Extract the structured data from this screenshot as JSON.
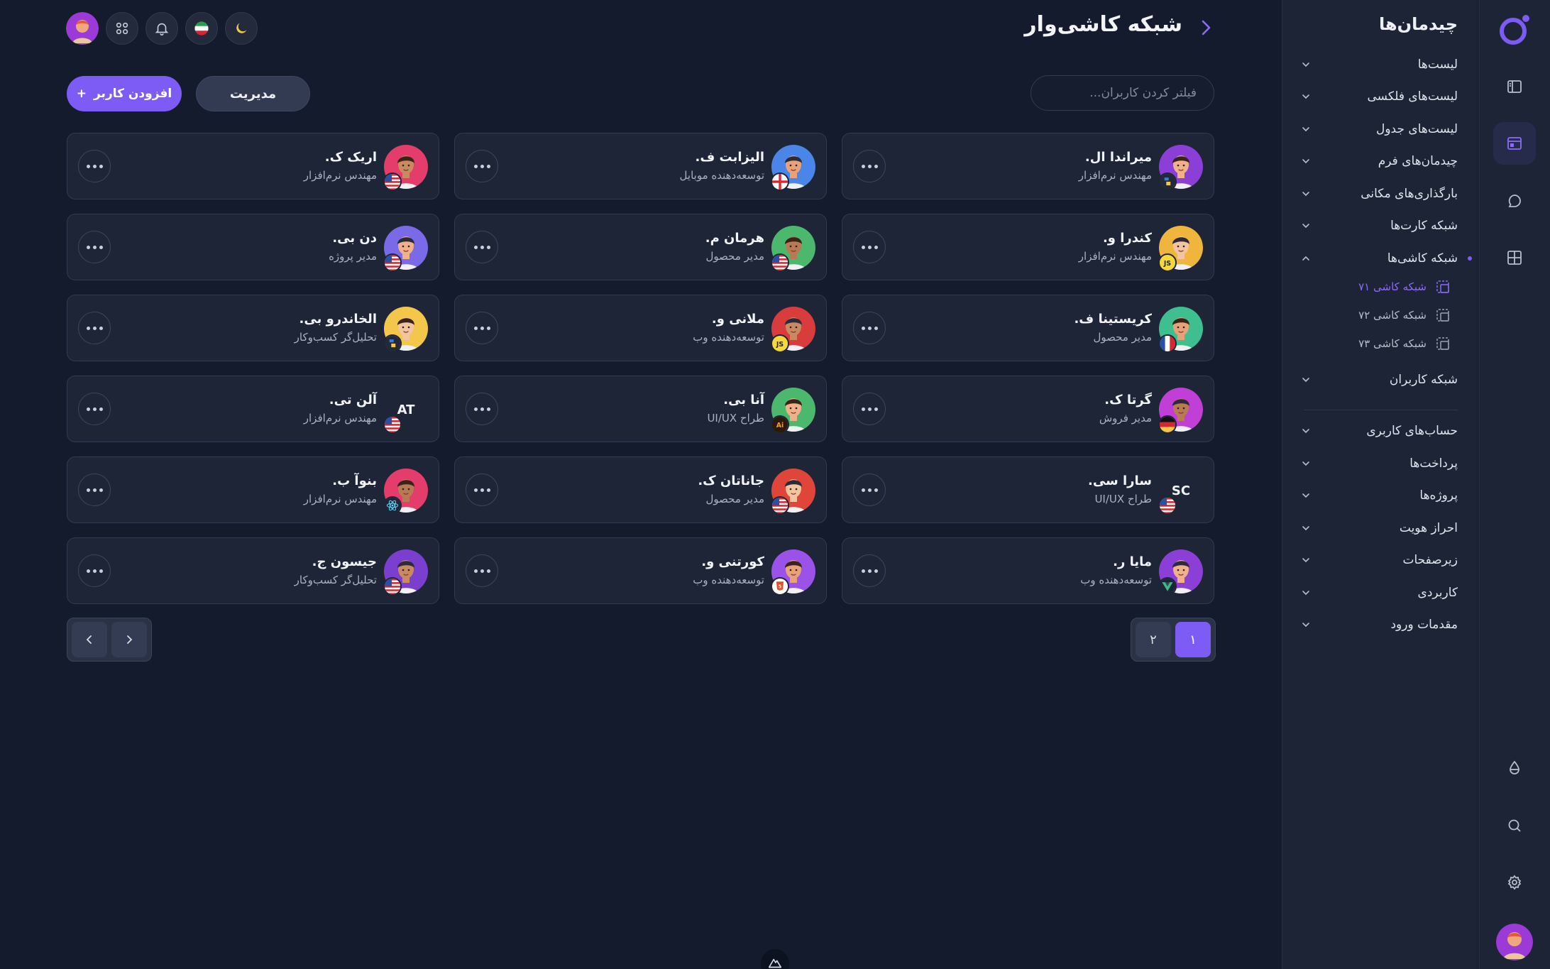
{
  "app": {
    "page_title": "شبکه کاشی‌وار",
    "accent_color": "#7d5cf5"
  },
  "sidebar": {
    "title": "چیدمان‌ها",
    "items": [
      {
        "label": "لیست‌ها"
      },
      {
        "label": "لیست‌های فلکسی"
      },
      {
        "label": "لیست‌های جدول"
      },
      {
        "label": "چیدمان‌های فرم"
      },
      {
        "label": "بارگذاری‌های مکانی"
      },
      {
        "label": "شبکه کارت‌ها"
      },
      {
        "label": "شبکه کاشی‌ها"
      },
      {
        "label": "شبکه کاربران"
      }
    ],
    "sub_items": [
      {
        "label": "شبکه کاشی ۷۱"
      },
      {
        "label": "شبکه کاشی ۷۲"
      },
      {
        "label": "شبکه کاشی ۷۳"
      }
    ],
    "bottom_items": [
      {
        "label": "حساب‌های کاربری"
      },
      {
        "label": "پرداخت‌ها"
      },
      {
        "label": "پروژه‌ها"
      },
      {
        "label": "احراز هویت"
      },
      {
        "label": "زیرصفحات"
      },
      {
        "label": "کاربردی"
      },
      {
        "label": "مقدمات ورود"
      }
    ]
  },
  "toolbar": {
    "search_placeholder": "فیلتر کردن کاربران...",
    "manage_label": "مدیریت",
    "add_user_label": "افزودن کاربر",
    "add_symbol": "+"
  },
  "users": [
    {
      "name": "میراندا ال.",
      "role": "مهندس نرم‌افزار",
      "color": "#8b3fd6",
      "badge": "python",
      "initials": ""
    },
    {
      "name": "الیزابت ف.",
      "role": "توسعه‌دهنده موبایل",
      "color": "#4a86e8",
      "badge": "flag-uk",
      "initials": ""
    },
    {
      "name": "اریک ک.",
      "role": "مهندس نرم‌افزار",
      "color": "#e43d6b",
      "badge": "flag-us",
      "initials": ""
    },
    {
      "name": "کندرا و.",
      "role": "مهندس نرم‌افزار",
      "color": "#f0b53d",
      "badge": "js",
      "initials": ""
    },
    {
      "name": "هرمان م.",
      "role": "مدیر محصول",
      "color": "#4cb86d",
      "badge": "flag-us",
      "initials": ""
    },
    {
      "name": "دن بی.",
      "role": "مدیر پروژه",
      "color": "#7a6ae8",
      "badge": "flag-us",
      "initials": ""
    },
    {
      "name": "کریستینا ف.",
      "role": "مدیر محصول",
      "color": "#3fbf8f",
      "badge": "flag-fr",
      "initials": ""
    },
    {
      "name": "ملانی و.",
      "role": "توسعه‌دهنده وب",
      "color": "#d93c3c",
      "badge": "js",
      "initials": ""
    },
    {
      "name": "الخاندرو بی.",
      "role": "تحلیل‌گر کسب‌وکار",
      "color": "#f2c74a",
      "badge": "python",
      "initials": ""
    },
    {
      "name": "گرتا ک.",
      "role": "مدیر فروش",
      "color": "#c03fd6",
      "badge": "flag-de",
      "initials": ""
    },
    {
      "name": "آنا بی.",
      "role": "طراح UI/UX",
      "color": "#4cb86d",
      "badge": "ai",
      "initials": ""
    },
    {
      "name": "آلن تی.",
      "role": "مهندس نرم‌افزار",
      "color": "",
      "badge": "flag-us",
      "initials": "AT"
    },
    {
      "name": "سارا سی.",
      "role": "طراح UI/UX",
      "color": "",
      "badge": "flag-us",
      "initials": "SC"
    },
    {
      "name": "جاناتان ک.",
      "role": "مدیر محصول",
      "color": "#e0453a",
      "badge": "flag-us",
      "initials": ""
    },
    {
      "name": "بنوآ ب.",
      "role": "مهندس نرم‌افزار",
      "color": "#e43d6b",
      "badge": "react",
      "initials": ""
    },
    {
      "name": "مایا ر.",
      "role": "توسعه‌دهنده وب",
      "color": "#8b3fd6",
      "badge": "vue",
      "initials": ""
    },
    {
      "name": "کورتنی و.",
      "role": "توسعه‌دهنده وب",
      "color": "#9b52e8",
      "badge": "html5",
      "initials": ""
    },
    {
      "name": "جیسون ج.",
      "role": "تحلیل‌گر کسب‌وکار",
      "color": "#7b3fd0",
      "badge": "flag-us",
      "initials": ""
    }
  ],
  "pagination": {
    "pages": [
      "۱",
      "۲"
    ],
    "current": "۱"
  }
}
